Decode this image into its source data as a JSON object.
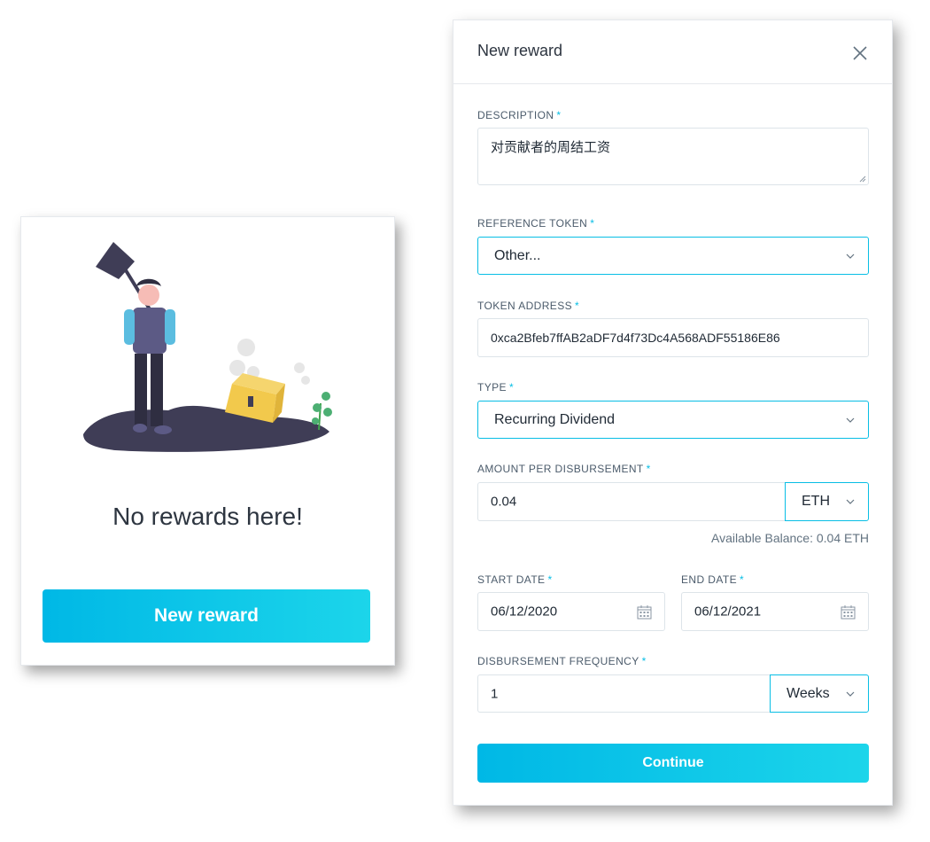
{
  "empty_card": {
    "title": "No rewards here!",
    "button_label": "New reward"
  },
  "panel": {
    "title": "New reward",
    "required_mark": "*",
    "description": {
      "label": "DESCRIPTION",
      "value": "对贡献者的周结工资"
    },
    "reference_token": {
      "label": "REFERENCE TOKEN",
      "value": "Other..."
    },
    "token_address": {
      "label": "TOKEN ADDRESS",
      "value": "0xca2Bfeb7ffAB2aDF7d4f73Dc4A568ADF55186E86"
    },
    "type": {
      "label": "TYPE",
      "value": "Recurring Dividend"
    },
    "amount": {
      "label": "AMOUNT PER DISBURSEMENT",
      "value": "0.04",
      "unit": "ETH",
      "hint": "Available Balance: 0.04 ETH"
    },
    "start_date": {
      "label": "START DATE",
      "value": "06/12/2020"
    },
    "end_date": {
      "label": "END DATE",
      "value": "06/12/2021"
    },
    "frequency": {
      "label": "DISBURSEMENT FREQUENCY",
      "value": "1",
      "unit": "Weeks"
    },
    "continue_label": "Continue"
  },
  "icons": {
    "close": "close-icon",
    "chevron": "chevron-down-icon",
    "calendar": "calendar-icon",
    "illustration": "empty-treasure-illustration"
  },
  "colors": {
    "accent": "#08bee5",
    "gradient_start": "#00b8e6",
    "gradient_end": "#1cd5ea"
  }
}
